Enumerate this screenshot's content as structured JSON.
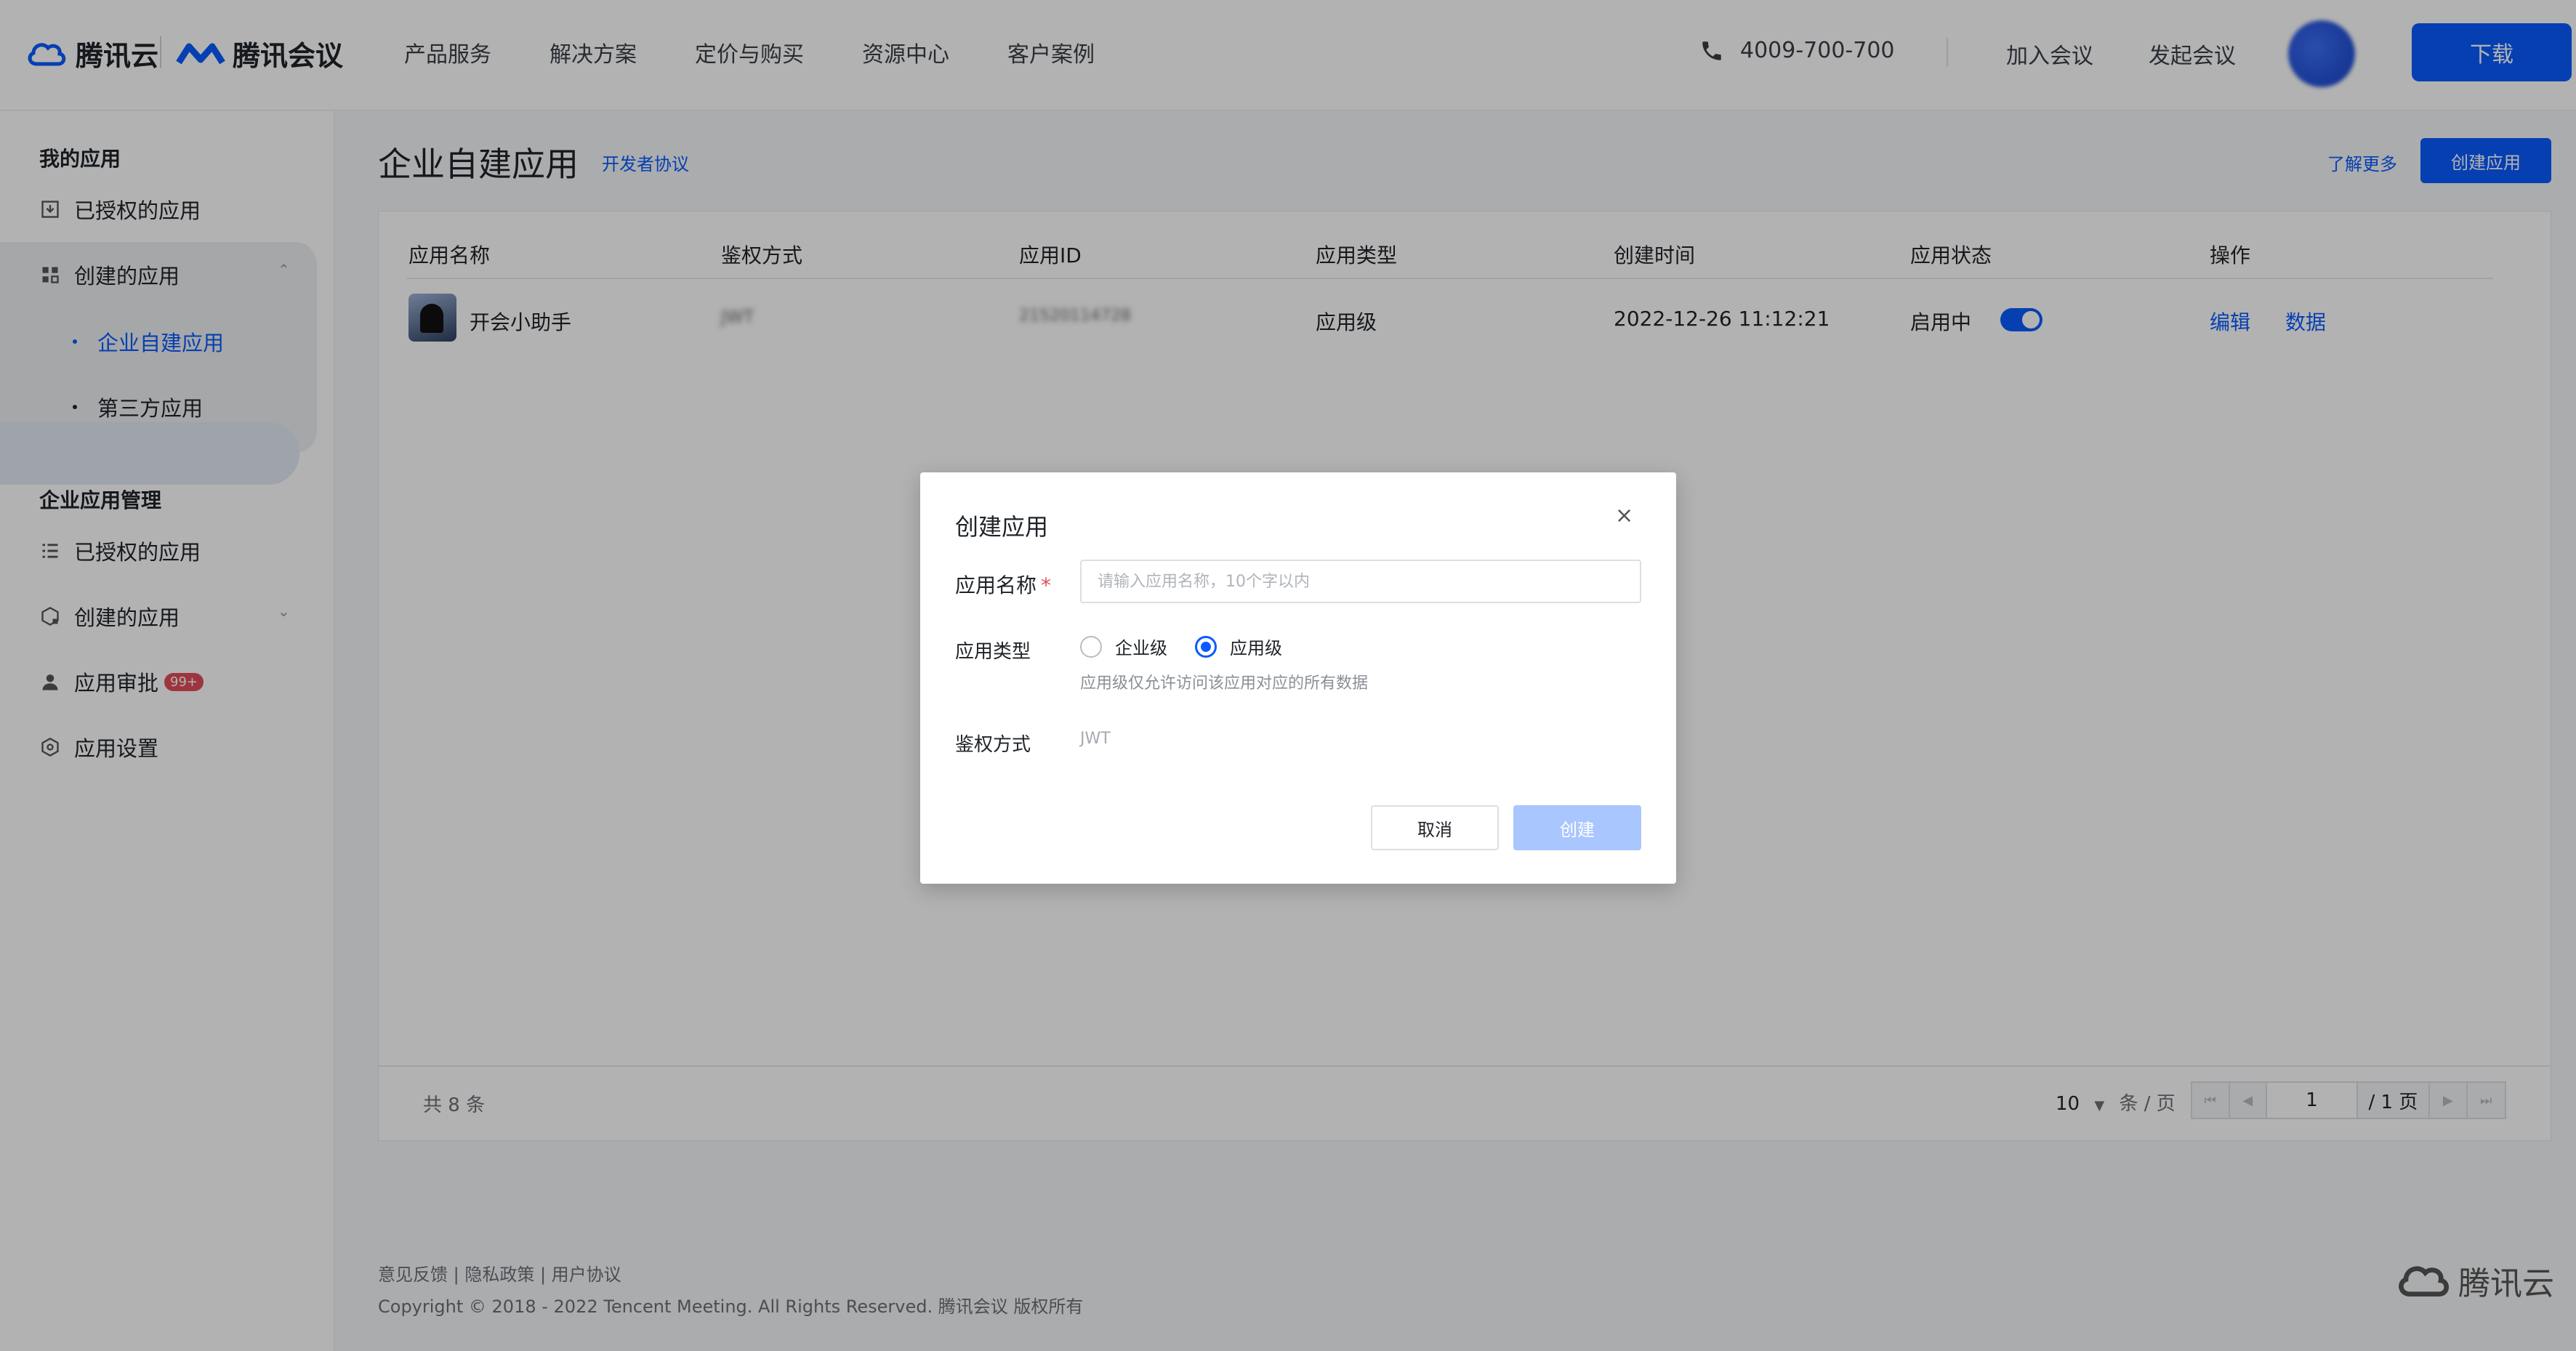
{
  "header": {
    "brand_cloud": "腾讯云",
    "brand_meeting": "腾讯会议",
    "nav": [
      "产品服务",
      "解决方案",
      "定价与购买",
      "资源中心",
      "客户案例"
    ],
    "phone": "4009-700-700",
    "join_meeting": "加入会议",
    "start_meeting": "发起会议",
    "download": "下载",
    "accent": "#0a5bff"
  },
  "sidebar": {
    "group1_title": "我的应用",
    "g1_authorized": "已授权的应用",
    "g1_created": "创建的应用",
    "g1_sub_enterprise": "企业自建应用",
    "g1_sub_third": "第三方应用",
    "group2_title": "企业应用管理",
    "g2_authorized": "已授权的应用",
    "g2_created": "创建的应用",
    "g2_approval": "应用审批",
    "g2_approval_badge": "99+",
    "g2_settings": "应用设置"
  },
  "main": {
    "title": "企业自建应用",
    "dev_agreement": "开发者协议",
    "learn_more": "了解更多",
    "create_app": "创建应用",
    "columns": [
      "应用名称",
      "鉴权方式",
      "应用ID",
      "应用类型",
      "创建时间",
      "应用状态",
      "操作"
    ],
    "row": {
      "name": "开会小助手",
      "auth": "JWT",
      "app_id": "21520114728",
      "type": "应用级",
      "created": "2022-12-26 11:12:21",
      "status": "启用中",
      "op_edit": "编辑",
      "op_data": "数据"
    },
    "total": "共 8 条",
    "page_size": "10",
    "page_size_unit": "条 / 页",
    "page_current": "1",
    "page_total": "/ 1 页"
  },
  "footer": {
    "links": "意见反馈 | 隐私政策 | 用户协议",
    "copyright": "Copyright © 2018 - 2022 Tencent Meeting. All Rights Reserved. 腾讯会议 版权所有",
    "logo_text": "腾讯云"
  },
  "modal": {
    "title": "创建应用",
    "close": "×",
    "name_label": "应用名称",
    "name_required": "*",
    "name_placeholder": "请输入应用名称，10个字以内",
    "type_label": "应用类型",
    "type_enterprise": "企业级",
    "type_app": "应用级",
    "type_hint": "应用级仅允许访问该应用对应的所有数据",
    "auth_label": "鉴权方式",
    "auth_value": "JWT",
    "cancel": "取消",
    "create": "创建"
  }
}
